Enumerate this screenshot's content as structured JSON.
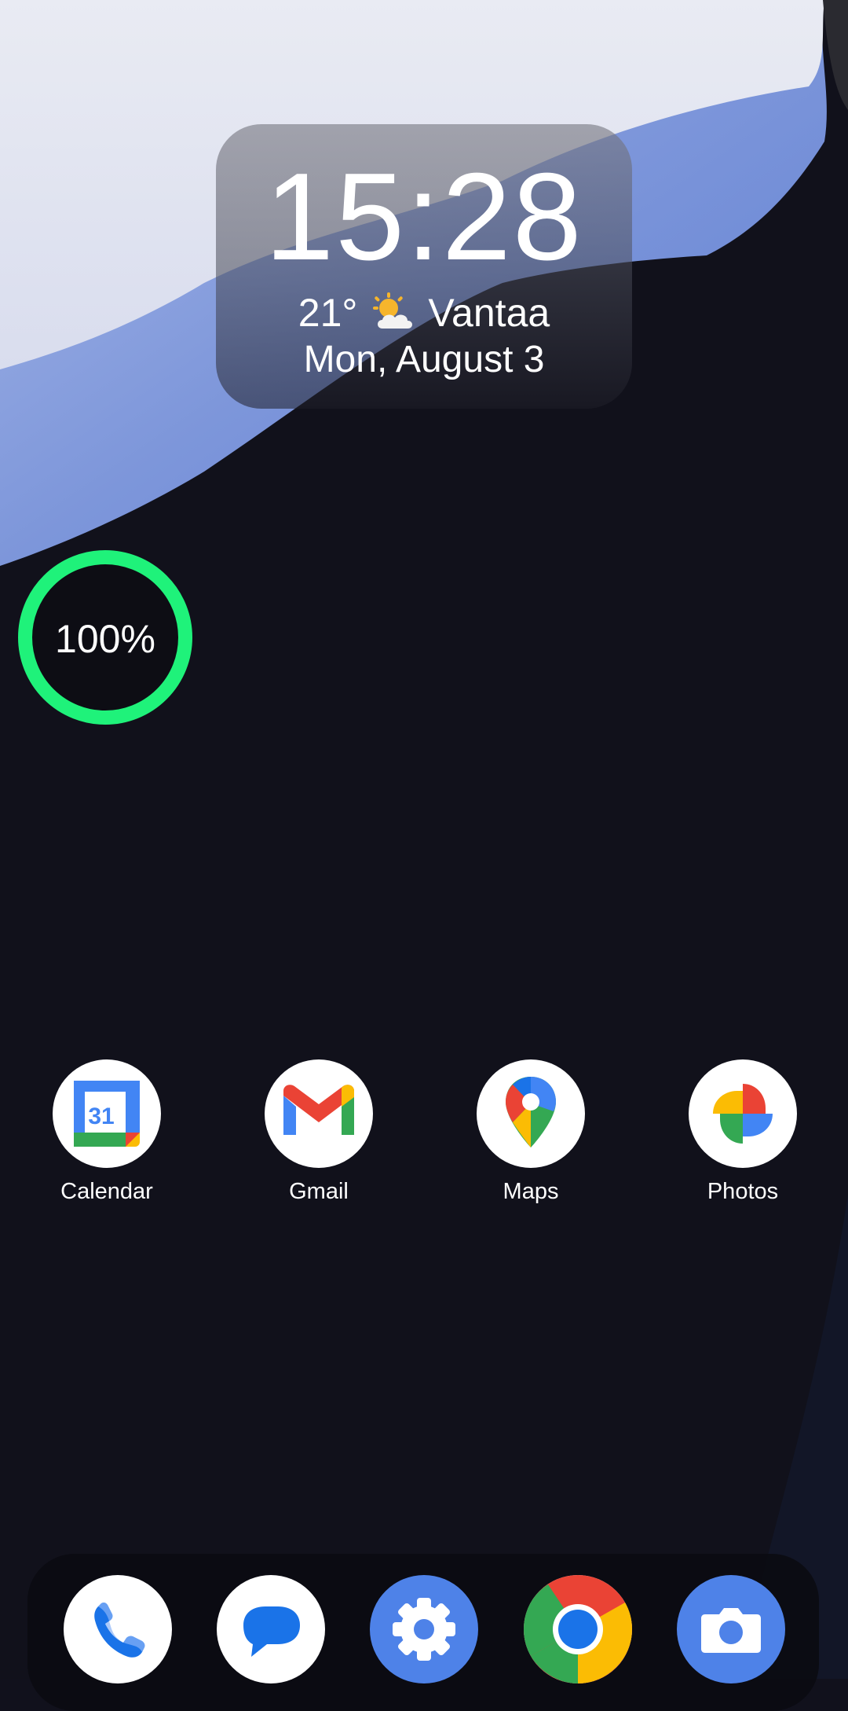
{
  "clock_widget": {
    "time": "15:28",
    "temperature": "21°",
    "weather_icon": "partly-sunny-icon",
    "city": "Vantaa",
    "date": "Mon, August 3"
  },
  "battery_widget": {
    "level_percent": 100,
    "label": "100%",
    "ring_color": "#1ff27a"
  },
  "apps": [
    {
      "label": "Calendar",
      "icon": "calendar-icon"
    },
    {
      "label": "Gmail",
      "icon": "gmail-icon"
    },
    {
      "label": "Maps",
      "icon": "maps-icon"
    },
    {
      "label": "Photos",
      "icon": "photos-icon"
    }
  ],
  "dock": [
    {
      "icon": "phone-icon"
    },
    {
      "icon": "messages-icon"
    },
    {
      "icon": "settings-icon"
    },
    {
      "icon": "chrome-icon"
    },
    {
      "icon": "camera-icon"
    }
  ]
}
